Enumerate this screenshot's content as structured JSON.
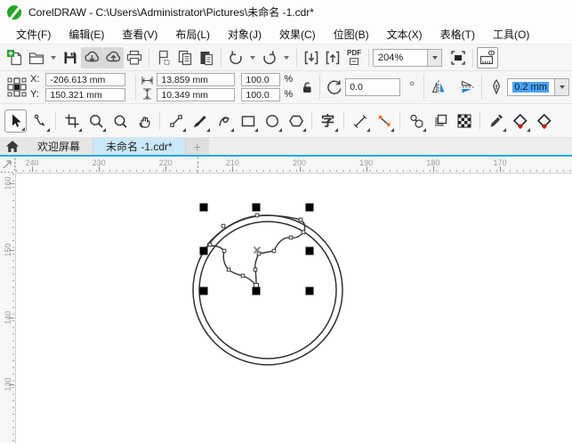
{
  "window": {
    "title": "CorelDRAW - C:\\Users\\Administrator\\Pictures\\未命名 -1.cdr*"
  },
  "menu": {
    "items": [
      "文件(F)",
      "编辑(E)",
      "查看(V)",
      "布局(L)",
      "对象(J)",
      "效果(C)",
      "位图(B)",
      "文本(X)",
      "表格(T)",
      "工具(O)"
    ]
  },
  "toolbar": {
    "zoom_level": "204%",
    "pdf_label": "PDF"
  },
  "property_bar": {
    "x_label": "X:",
    "x_value": "-206.613 mm",
    "y_label": "Y:",
    "y_value": "150.321 mm",
    "width_value": "13.859 mm",
    "height_value": "10.349 mm",
    "scale_x": "100.0",
    "scale_y": "100.0",
    "percent_x": "%",
    "percent_y": "%",
    "rotation": "0.0",
    "degree": "°",
    "outline_width": "0.2 mm"
  },
  "toolbox": {
    "text_tool_glyph": "字"
  },
  "tabs": {
    "welcome_label": "欢迎屏幕",
    "document_label": "未命名 -1.cdr*",
    "new_tab_label": "+"
  },
  "rulers": {
    "horizontal_labels": [
      "240",
      "230",
      "220",
      "210",
      "200",
      "190",
      "180",
      "170"
    ],
    "vertical_labels": [
      "160",
      "150",
      "140",
      "130"
    ]
  },
  "colors": {
    "logo_green": "#25a525",
    "tab_active_bg": "#cbe8f9",
    "tab_underline": "#29a9e1",
    "selection_highlight": "#4da3f0",
    "connector_node_orange": "#e8731a",
    "fill_tool_red": "#d11a1a"
  }
}
